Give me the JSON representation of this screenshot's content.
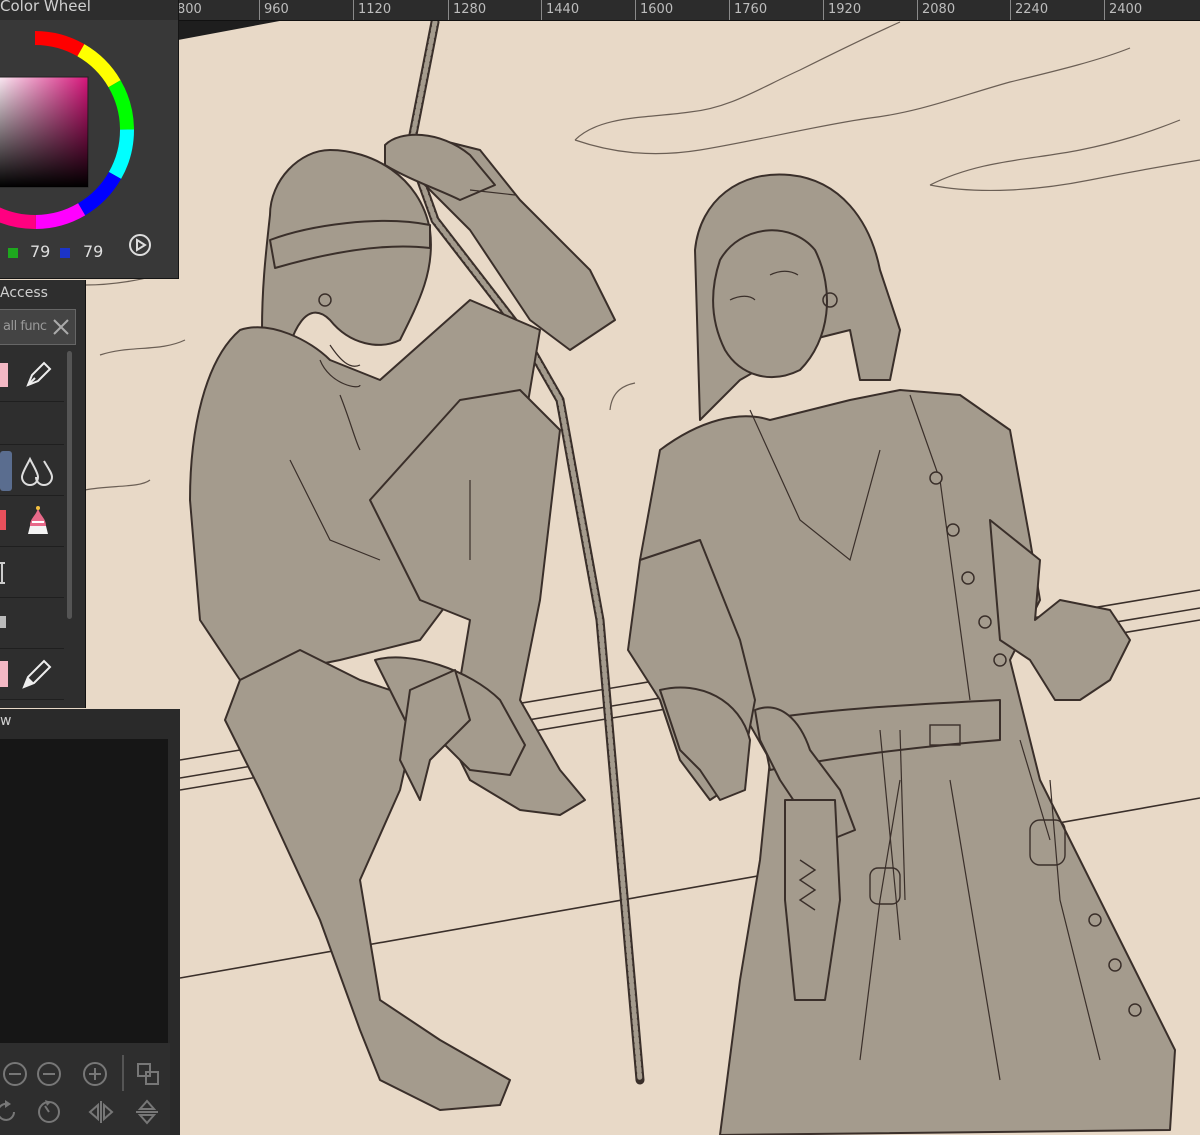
{
  "ruler": {
    "labels": [
      "800",
      "960",
      "1120",
      "1280",
      "1440",
      "1600",
      "1760",
      "1920",
      "2080",
      "2240",
      "2400"
    ]
  },
  "color_wheel": {
    "title": "Color Wheel",
    "green_value": "79",
    "blue_value": "79",
    "main_color": "#8a1548",
    "green_swatch": "#1ea81e",
    "blue_swatch": "#1c34c8"
  },
  "quick_access": {
    "title": "Access",
    "search_placeholder": "all func"
  },
  "navigator": {
    "title": "w"
  },
  "icons": [
    "pen-icon",
    "water-drop-icon",
    "cake-icon",
    "spacer-icon",
    "brush-icon",
    "zoom-out-icon",
    "zoom-in-icon",
    "fit-screen-icon",
    "rotate-icon",
    "reset-rotation-icon",
    "flip-horizontal-icon",
    "flip-vertical-icon"
  ],
  "canvas": {
    "background": "#e8d9c7",
    "figure_fill": "#a49b8d",
    "line_color": "#3a2f2a"
  }
}
